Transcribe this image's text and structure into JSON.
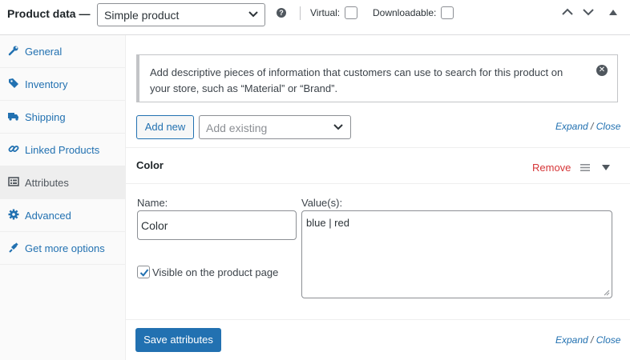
{
  "header": {
    "title": "Product data —",
    "product_type": "Simple product",
    "help_glyph": "?",
    "virtual_label": "Virtual:",
    "downloadable_label": "Downloadable:"
  },
  "sidebar": {
    "items": [
      {
        "label": "General",
        "icon": "wrench-icon",
        "active": false
      },
      {
        "label": "Inventory",
        "icon": "tag-icon",
        "active": false
      },
      {
        "label": "Shipping",
        "icon": "truck-icon",
        "active": false
      },
      {
        "label": "Linked Products",
        "icon": "link-icon",
        "active": false
      },
      {
        "label": "Attributes",
        "icon": "list-icon",
        "active": true
      },
      {
        "label": "Advanced",
        "icon": "gear-icon",
        "active": false
      },
      {
        "label": "Get more options",
        "icon": "plugin-icon",
        "active": false
      }
    ]
  },
  "notice": {
    "text": "Add descriptive pieces of information that customers can use to search for this product on your store, such as “Material” or “Brand”.",
    "close_glyph": "✕"
  },
  "toolbar": {
    "add_new_label": "Add new",
    "add_existing_placeholder": "Add existing",
    "expand_label": "Expand",
    "slash": "/",
    "close_label": "Close"
  },
  "attribute": {
    "title": "Color",
    "remove_label": "Remove",
    "name_label": "Name:",
    "name_value": "Color",
    "values_label": "Value(s):",
    "values_value": "blue | red",
    "visible_label": "Visible on the product page",
    "visible_checked": true
  },
  "footer": {
    "save_label": "Save attributes",
    "expand_label": "Expand",
    "slash": "/",
    "close_label": "Close"
  },
  "colors": {
    "accent": "#2271b1",
    "danger": "#d63638",
    "sidebar_bg": "#fafafa"
  }
}
